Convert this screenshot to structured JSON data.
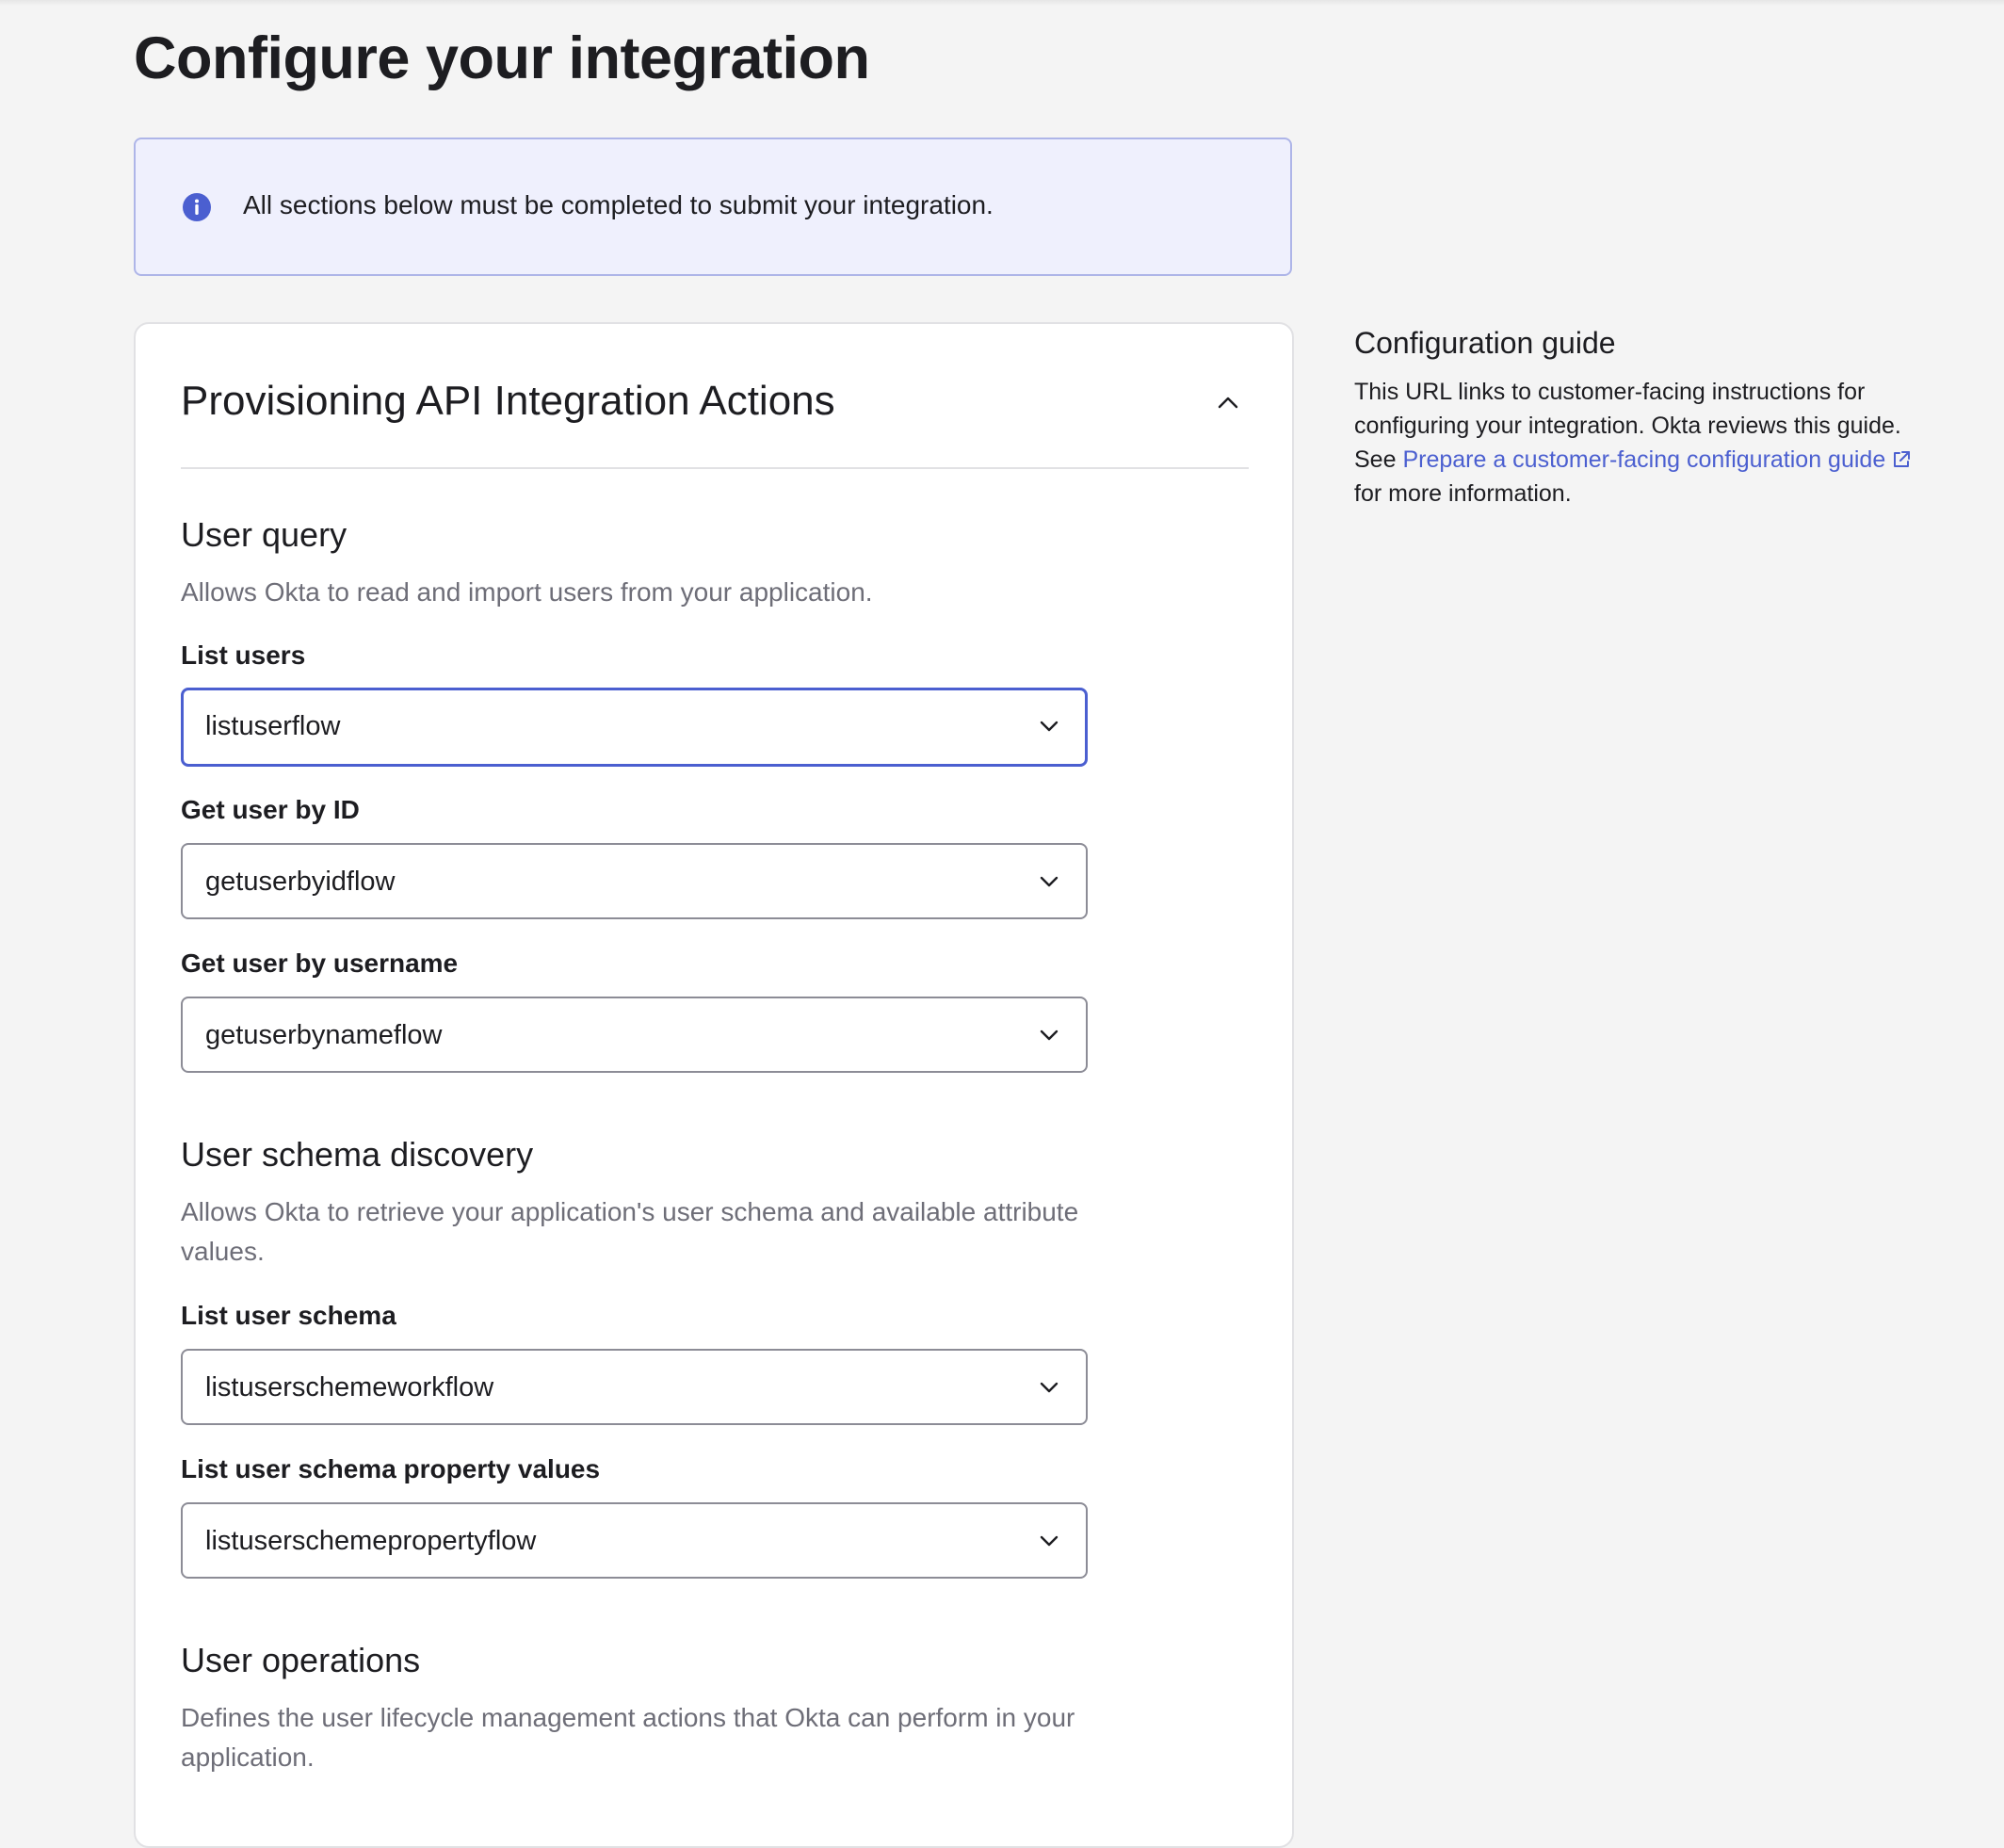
{
  "page": {
    "title": "Configure your integration"
  },
  "banner": {
    "icon": "info-icon",
    "text": "All sections below must be completed to submit your integration.",
    "accent": "#4b5fd0"
  },
  "card": {
    "title": "Provisioning API Integration Actions",
    "collapse_icon": "chevron-up-icon"
  },
  "sections": {
    "user_query": {
      "title": "User query",
      "description": "Allows Okta to read and import users from your application.",
      "fields": [
        {
          "label": "List users",
          "value": "listuserflow",
          "focused": true
        },
        {
          "label": "Get user by ID",
          "value": "getuserbyidflow"
        },
        {
          "label": "Get user by username",
          "value": "getuserbynameflow"
        }
      ]
    },
    "user_schema_discovery": {
      "title": "User schema discovery",
      "description": "Allows Okta to retrieve your application's user schema and available attribute values.",
      "fields": [
        {
          "label": "List user schema",
          "value": "listuserschemeworkflow"
        },
        {
          "label": "List user schema property values",
          "value": "listuserschemepropertyflow"
        }
      ]
    },
    "user_operations": {
      "title": "User operations",
      "description": "Defines the user lifecycle management actions that Okta can perform in your application."
    }
  },
  "guide": {
    "title": "Configuration guide",
    "text_before": "This URL links to customer-facing instructions for configuring your integration. Okta reviews this guide. See ",
    "link_text": "Prepare a customer-facing configuration guide",
    "link_icon": "external-link-icon",
    "text_after": " for more information."
  },
  "colors": {
    "background": "#f4f4f4",
    "link": "#4b5fd0",
    "focus_border": "#4b5fd0",
    "banner_bg": "#eff0fd"
  }
}
